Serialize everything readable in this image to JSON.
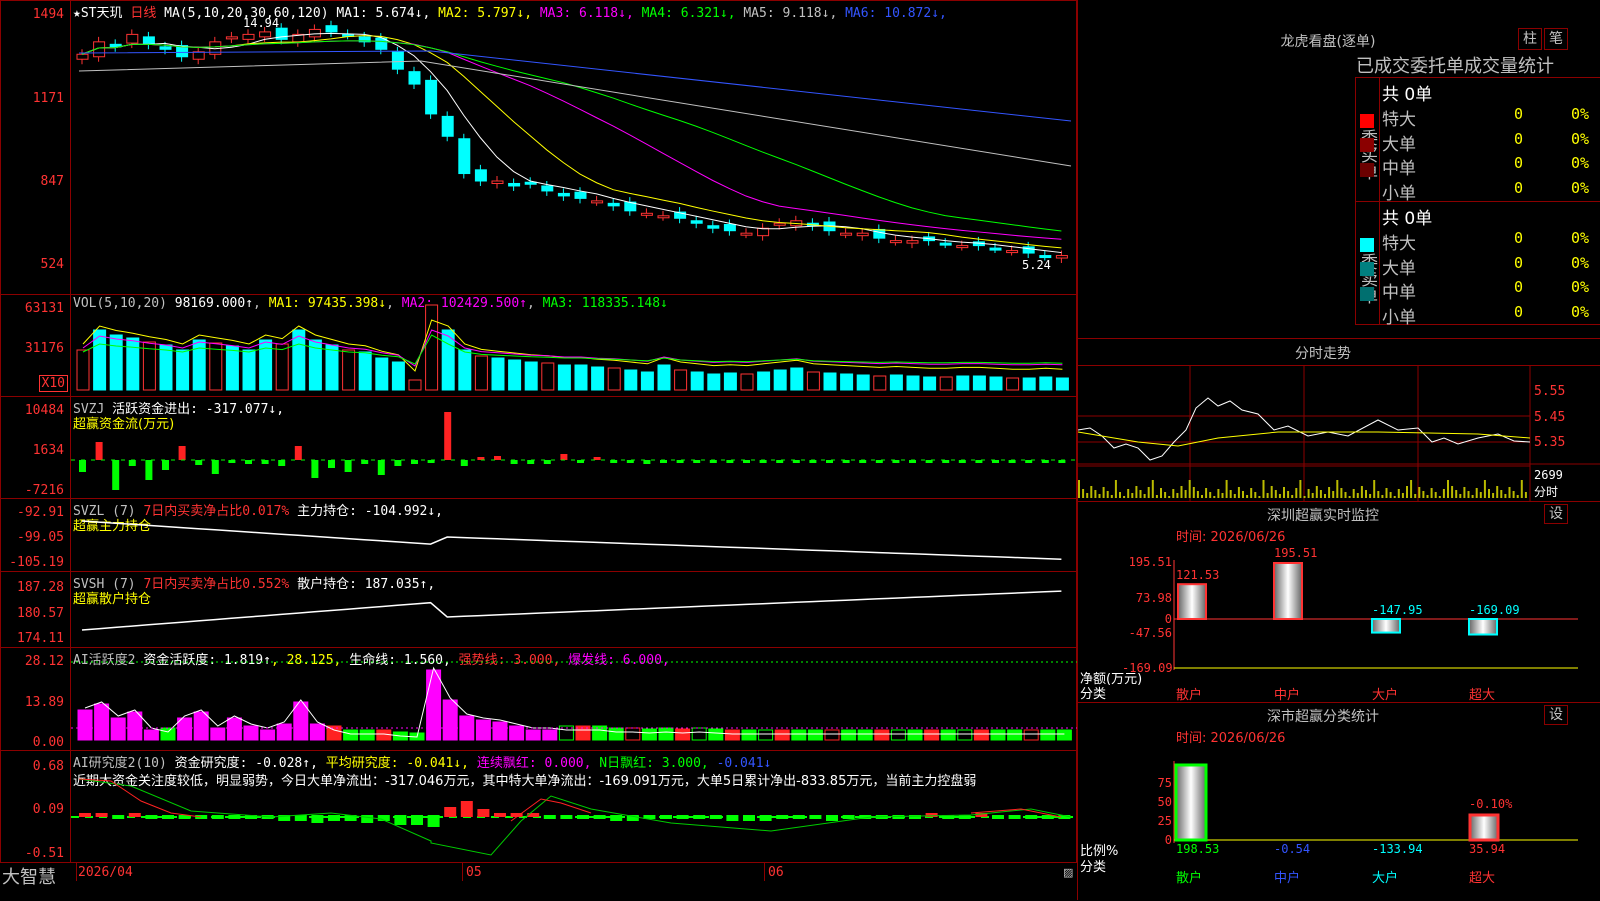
{
  "main": {
    "stock_title": "★ST天玑",
    "period": "日线",
    "ma_header": "MA(5,10,20,30,60,120)",
    "ma_values": [
      {
        "label": "MA1:",
        "value": "5.674↓",
        "color": "#ffffff"
      },
      {
        "label": "MA2:",
        "value": "5.797↓",
        "color": "#ffff00"
      },
      {
        "label": "MA3:",
        "value": "6.118↓",
        "color": "#ff00ff"
      },
      {
        "label": "MA4:",
        "value": "6.321↓",
        "color": "#00ff00"
      },
      {
        "label": "MA5:",
        "value": "9.118↓",
        "color": "#c0c0c0"
      },
      {
        "label": "MA6:",
        "value": "10.872↓",
        "color": "#3355ff"
      }
    ],
    "y_ticks": [
      "1494",
      "1171",
      "847",
      "524"
    ],
    "high_label": "14.94",
    "low_label": "5.24"
  },
  "vol": {
    "header": "VOL(5,10,20)",
    "value": "98169.000↑",
    "ma1": "MA1: 97435.398↓",
    "ma2": "MA2: 102429.500↑",
    "ma3": "MA3: 118335.148↓",
    "y_ticks": [
      "63131",
      "31176"
    ],
    "unit": "X10"
  },
  "svzj": {
    "header": "SVZJ",
    "label": "活跃资金进出: -317.077↓,",
    "sub": "超赢资金流(万元)",
    "y_ticks": [
      "10484",
      "1634",
      "-7216"
    ]
  },
  "svzl": {
    "header": "SVZL (7)",
    "ratio": "7日内买卖净占比0.017%",
    "hold": "主力持仓: -104.992↓,",
    "sub": "超赢主力持仓",
    "y_ticks": [
      "-92.91",
      "-99.05",
      "-105.19"
    ]
  },
  "svsh": {
    "header": "SVSH (7)",
    "ratio": "7日内买卖净占比0.552%",
    "hold": "散户持仓: 187.035↑,",
    "sub": "超赢散户持仓",
    "y_ticks": [
      "187.28",
      "180.57",
      "174.11"
    ]
  },
  "ai1": {
    "header": "AI活跃度2",
    "a": "资金活跃度: 1.819↑",
    "b": ", 28.125,",
    "c": "生命线: 1.560,",
    "d": "强势线: 3.000,",
    "e": "爆发线: 6.000,",
    "y_ticks": [
      "28.12",
      "13.89",
      "0.00"
    ]
  },
  "ai2": {
    "header": "AI研究度2(10)",
    "a": "资金研究度: -0.028↑,",
    "b": "平均研究度: -0.041↓,",
    "c": "连续飘红: 0.000,",
    "d": "N日飘红: 3.000,",
    "e": "-0.041↓",
    "commentary": "近期大资金关注度较低，明显弱势，今日大单净流出：-317.046万元，其中特大单净流出：-169.091万元，大单5日累计净出-833.85万元，当前主力控盘弱",
    "y_ticks": [
      "0.68",
      "0.09",
      "-0.51"
    ]
  },
  "bottom": {
    "brand": "大智慧",
    "dates": [
      "2026/04",
      "05",
      "06"
    ]
  },
  "lhb": {
    "title": "龙虎看盘(逐单)",
    "btn1": "柱",
    "btn2": "笔",
    "subtitle": "已成交委托单成交量统计",
    "buy_label": "委买单",
    "sell_label": "委卖单",
    "buy_total": "共 0单",
    "sell_total": "共 0单",
    "buy_rows": [
      {
        "label": "特大",
        "v": "0",
        "p": "0%",
        "color": "#ff0000"
      },
      {
        "label": "大单",
        "v": "0",
        "p": "0%",
        "color": "#8b0000"
      },
      {
        "label": "中单",
        "v": "0",
        "p": "0%",
        "color": "#6b0000"
      },
      {
        "label": "小单",
        "v": "0",
        "p": "0%",
        "color": ""
      }
    ],
    "sell_rows": [
      {
        "label": "特大",
        "v": "0",
        "p": "0%",
        "color": "#00ffff"
      },
      {
        "label": "大单",
        "v": "0",
        "p": "0%",
        "color": "#008080"
      },
      {
        "label": "中单",
        "v": "0",
        "p": "0%",
        "color": "#006f6f"
      },
      {
        "label": "小单",
        "v": "0",
        "p": "0%",
        "color": ""
      }
    ]
  },
  "intraday": {
    "title": "分时走势",
    "y_ticks": [
      "5.55",
      "5.45",
      "5.35"
    ],
    "vol_label": "2699",
    "vol_unit": "分时"
  },
  "monitor": {
    "title": "深圳超赢实时监控",
    "btn": "设",
    "time": "时间: 2026/06/26",
    "y_ticks": [
      "195.51",
      "73.98",
      "0",
      "-47.56",
      "-169.09"
    ],
    "ylabel1": "净额(万元)",
    "ylabel2": "分类",
    "bar_values": [
      "121.53",
      "195.51",
      "-147.95",
      "-169.09"
    ],
    "categories": [
      "散户",
      "中户",
      "大户",
      "超大"
    ]
  },
  "classify": {
    "title": "深市超赢分类统计",
    "btn": "设",
    "time": "时间: 2026/06/26",
    "y_ticks": [
      "75",
      "50",
      "25",
      "0"
    ],
    "pct_label": "-0.10%",
    "ylabel1": "比例%",
    "ylabel2": "分类",
    "values": [
      "198.53",
      "-0.54",
      "-133.94",
      "35.94"
    ],
    "categories": [
      "散户",
      "中户",
      "大户",
      "超大"
    ]
  }
}
